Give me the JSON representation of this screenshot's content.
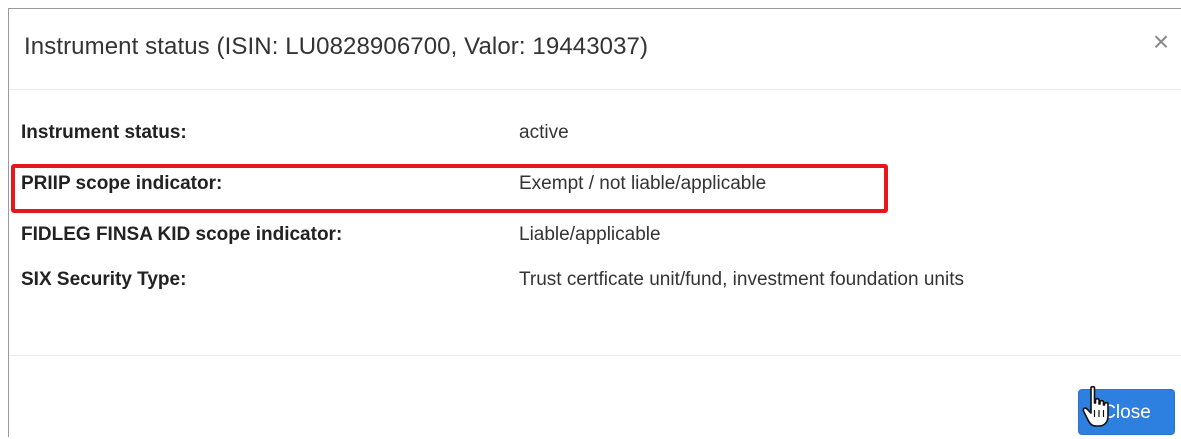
{
  "dialog": {
    "title": "Instrument status (ISIN: LU0828906700, Valor: 19443037)",
    "close_symbol": "×"
  },
  "details": [
    {
      "label": "Instrument status:",
      "value": "active"
    },
    {
      "label": "PRIIP scope indicator:",
      "value": "Exempt / not liable/applicable"
    },
    {
      "label": "FIDLEG FINSA KID scope indicator:",
      "value": "Liable/applicable"
    },
    {
      "label": "SIX Security Type:",
      "value": "Trust certficate unit/fund, investment foundation units"
    }
  ],
  "highlight": {
    "row": "PRIIP scope indicator:",
    "color": "#e8161b"
  },
  "footer": {
    "close_button_label": "Close"
  },
  "colors": {
    "primary": "#2d7fe0",
    "highlight": "#e8161b"
  },
  "icons": {
    "close": "close-icon",
    "cursor": "hand-pointer-cursor-icon"
  }
}
